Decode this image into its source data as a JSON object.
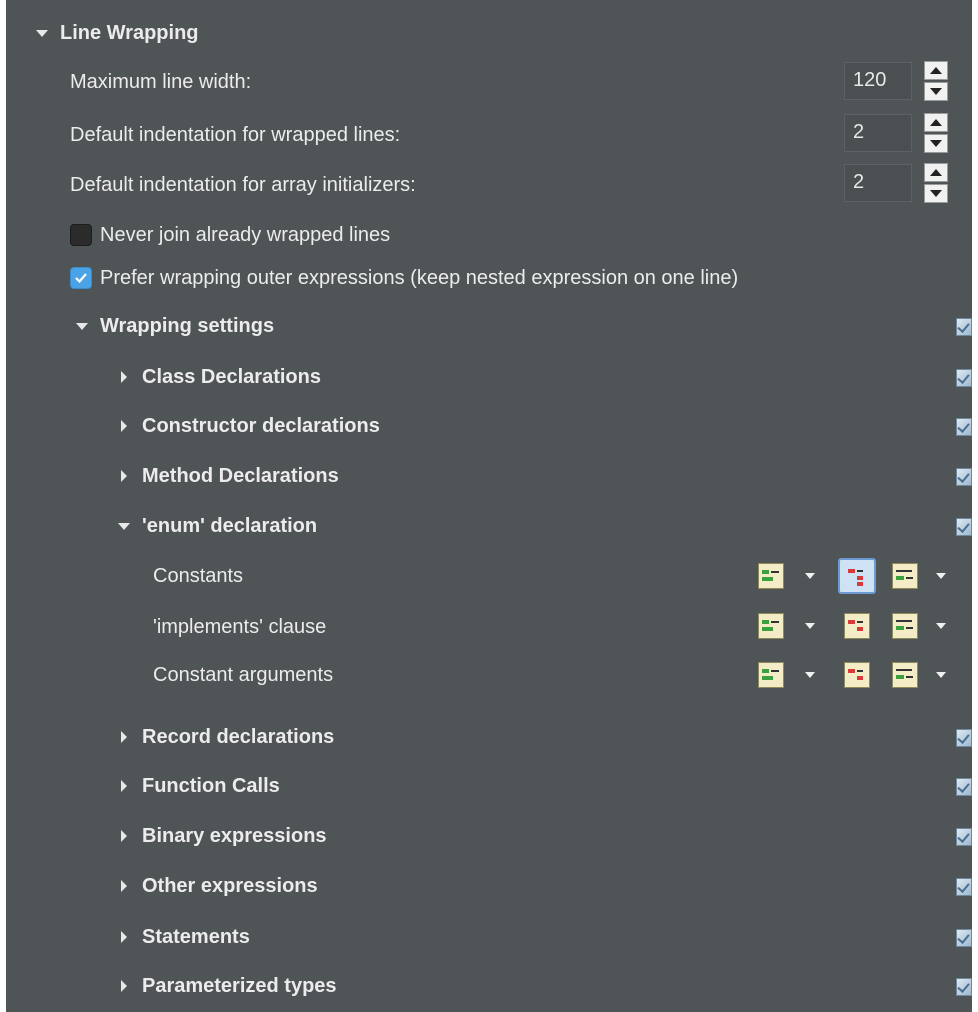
{
  "section": {
    "title": "Line Wrapping"
  },
  "fields": [
    {
      "label": "Maximum line width:",
      "value": "120"
    },
    {
      "label": "Default indentation for wrapped lines:",
      "value": "2"
    },
    {
      "label": "Default indentation for array initializers:",
      "value": "2"
    }
  ],
  "checkboxes": [
    {
      "label": "Never join already wrapped lines",
      "checked": false
    },
    {
      "label": "Prefer wrapping outer expressions (keep nested expression on one line)",
      "checked": true
    }
  ],
  "wrapping": {
    "title": "Wrapping settings",
    "items": [
      {
        "label": "Class Declarations",
        "expanded": false
      },
      {
        "label": "Constructor declarations",
        "expanded": false
      },
      {
        "label": "Method Declarations",
        "expanded": false
      },
      {
        "label": "'enum' declaration",
        "expanded": true
      },
      {
        "label": "Record declarations",
        "expanded": false
      },
      {
        "label": "Function Calls",
        "expanded": false
      },
      {
        "label": "Binary expressions",
        "expanded": false
      },
      {
        "label": "Other expressions",
        "expanded": false
      },
      {
        "label": "Statements",
        "expanded": false
      },
      {
        "label": "Parameterized types",
        "expanded": false
      }
    ],
    "enum_children": [
      {
        "label": "Constants"
      },
      {
        "label": "'implements' clause"
      },
      {
        "label": "Constant arguments"
      }
    ]
  },
  "icons": {
    "expand": "triangle-down-icon",
    "collapse": "triangle-right-icon",
    "side": "checkbox-tree-icon",
    "policy": "wrap-policy-icon",
    "force": "force-split-icon",
    "indent": "indent-policy-icon"
  },
  "colors": {
    "panel_bg": "#4f5456",
    "text": "#ececec",
    "check_accent": "#4aa3e6"
  }
}
